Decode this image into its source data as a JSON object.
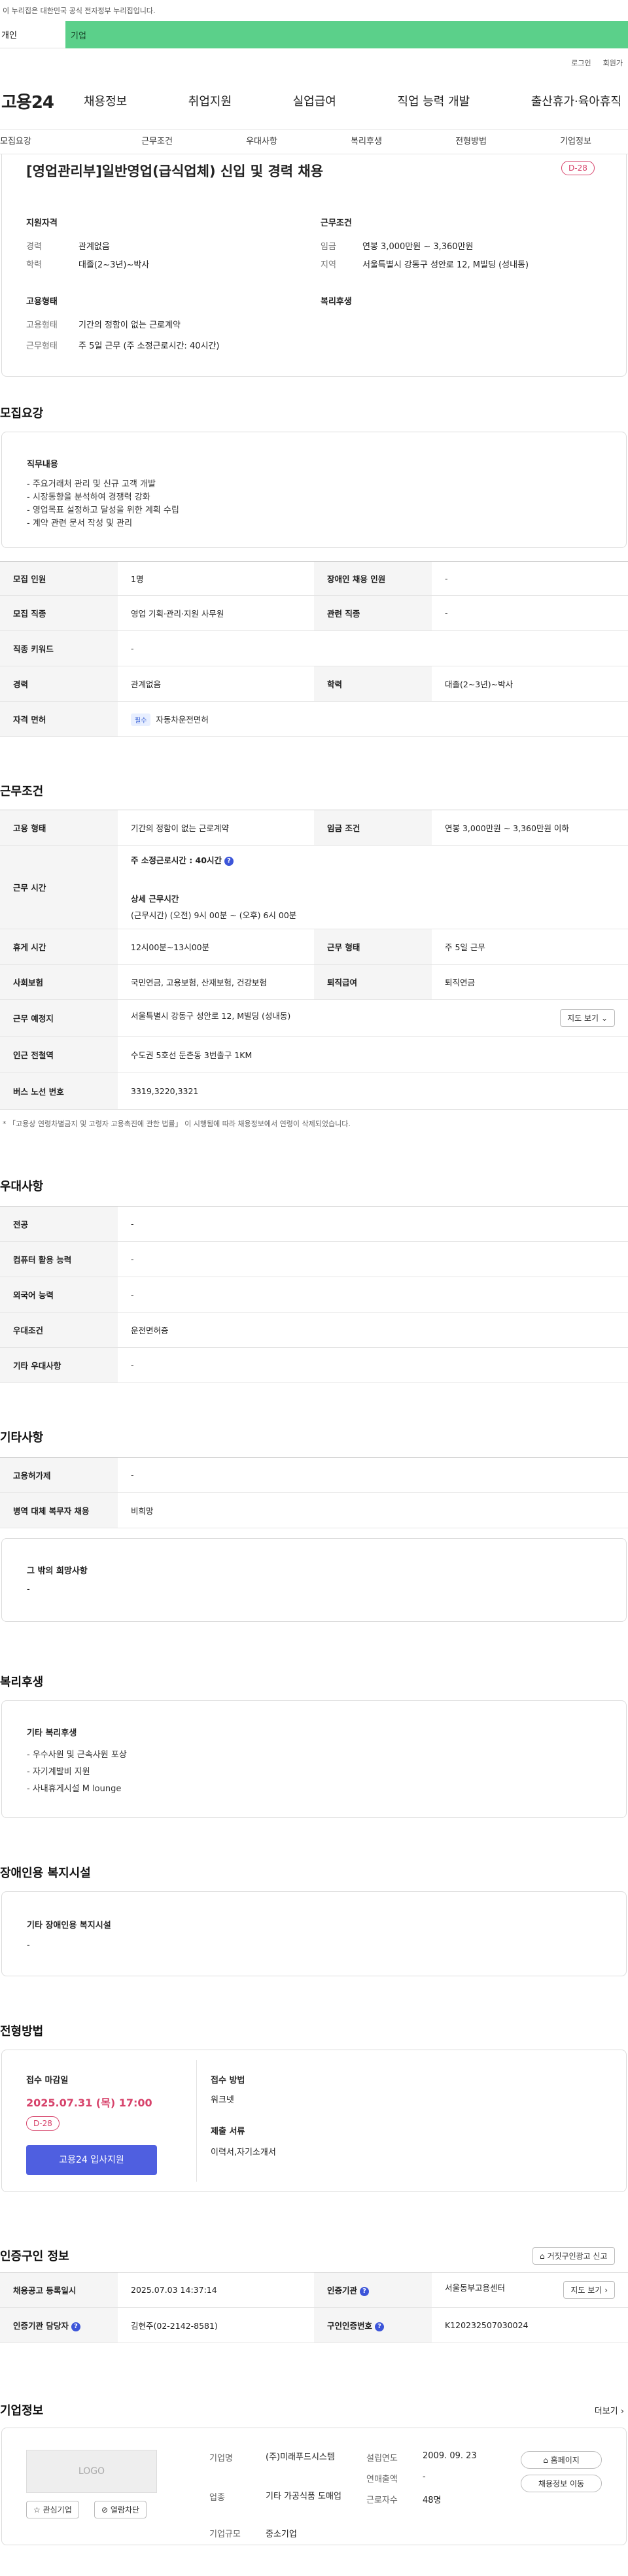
{
  "gov_bar": {
    "text": "이 누리집은 대한민국 공식 전자정부 누리집입니다."
  },
  "tabs": [
    {
      "label": "개인"
    },
    {
      "label": "기업"
    }
  ],
  "top_links": [
    {
      "label": "로그인"
    },
    {
      "label": "회원가"
    }
  ],
  "gnb": {
    "logo": "고용24",
    "items": [
      {
        "label": "채용정보"
      },
      {
        "label": "취업지원"
      },
      {
        "label": "실업급여"
      },
      {
        "label": "직업 능력 개발"
      },
      {
        "label": "출산휴가·육아휴직"
      }
    ]
  },
  "subnav": [
    {
      "label": "모집요강"
    },
    {
      "label": "근무조건"
    },
    {
      "label": "우대사항"
    },
    {
      "label": "복리후생"
    },
    {
      "label": "전형방법"
    },
    {
      "label": "기업정보"
    }
  ],
  "summary": {
    "title": "[영업관리부]일반영업(급식업체) 신입 및 경력 채용",
    "dday": "D-28",
    "qual_heading": "지원자격",
    "career_k": "경력",
    "career_v": "관계없음",
    "edu_k": "학력",
    "edu_v": "대졸(2~3년)~박사",
    "cond_heading": "근무조건",
    "wage_k": "임금",
    "wage_v": "연봉 3,000만원 ~ 3,360만원",
    "region_k": "지역",
    "region_v": "서울특별시 강동구 성안로 12, M빌딩 (성내동)",
    "emp_heading": "고용형태",
    "type_k": "고용형태",
    "type_v": "기간의 정함이 없는 근로계약",
    "form_k": "근무형태",
    "form_v": "주 5일 근무 (주 소정근로시간: 40시간)",
    "welfare_heading": "복리후생"
  },
  "recruit": {
    "title": "모집요강",
    "duty_heading": "직무내용",
    "duties": [
      "- 주요거래처 관리 및 신규 고객 개발",
      "- 시장동향을 분석하여 경쟁력 강화",
      "- 영업목표 설정하고 달성을 위한 계획 수립",
      "- 계약 관련 문서 작성 및 관리"
    ],
    "rows": [
      {
        "k1": "모집 인원",
        "v1": "1명",
        "k2": "장애인 채용 인원",
        "v2": "-"
      },
      {
        "k1": "모집 직종",
        "v1": "영업 기획·관리·지원 사무원",
        "k2": "관련 직종",
        "v2": "-"
      },
      {
        "k1": "직종 키워드",
        "v1": "-"
      },
      {
        "k1": "경력",
        "v1": "관계없음",
        "k2": "학력",
        "v2": "대졸(2~3년)~박사"
      },
      {
        "k1": "자격 면허",
        "badge": "필수",
        "v1": "자동차운전면허"
      }
    ]
  },
  "work": {
    "title": "근무조건",
    "emp_type_k": "고용 형태",
    "emp_type_v": "기간의 정함이 없는 근로계약",
    "wage_k": "임금 조건",
    "wage_v": "연봉 3,000만원 ~ 3,360만원 이하",
    "hours_k": "근무 시간",
    "hours_weekly": "주 소정근로시간 : 40시간",
    "hours_detail_h": "상세 근무시간",
    "hours_detail": "(근무시간) (오전) 9시 00분 ~ (오후) 6시 00분",
    "rest_k": "휴게 시간",
    "rest_v": "12시00분~13시00분",
    "form_k": "근무 형태",
    "form_v": "주 5일 근무",
    "ins_k": "사회보험",
    "ins_v": "국민연금, 고용보험, 산재보험, 건강보험",
    "sev_k": "퇴직급여",
    "sev_v": "퇴직연금",
    "loc_k": "근무 예정지",
    "loc_v": "서울특별시 강동구 성안로 12, M빌딩 (성내동)",
    "map_btn": "지도 보기",
    "subway_k": "인근 전철역",
    "subway_v": "수도권 5호선 둔촌동 3번출구 1KM",
    "bus_k": "버스 노선 번호",
    "bus_v": "3319,3220,3321",
    "note": "* 「고용상 연령차별금지 및 고령자 고용촉진에 관한 법률」 이 시행됨에 따라 채용정보에서 연령이 삭제되었습니다."
  },
  "pref": {
    "title": "우대사항",
    "rows": [
      {
        "k": "전공",
        "v": "-"
      },
      {
        "k": "컴퓨터 활용 능력",
        "v": "-"
      },
      {
        "k": "외국어 능력",
        "v": "-"
      },
      {
        "k": "우대조건",
        "v": "운전면허증"
      },
      {
        "k": "기타 우대사항",
        "v": "-"
      }
    ]
  },
  "etc": {
    "title": "기타사항",
    "rows": [
      {
        "k": "고용허가제",
        "v": "-"
      },
      {
        "k": "병역 대체 복무자 채용",
        "v": "비희망"
      }
    ],
    "other_h": "그 밖의 희망사항",
    "other_v": "-"
  },
  "welfare": {
    "title": "복리후생",
    "box_h": "기타 복리후생",
    "items": [
      "- 우수사원 및 근속사원 포상",
      "- 자기계발비 지원",
      "- 사내휴게시설 M lounge"
    ]
  },
  "disab": {
    "title": "장애인용 복지시설",
    "box_h": "기타 장애인용 복지시설",
    "v": "-"
  },
  "process": {
    "title": "전형방법",
    "deadline_h": "접수 마감일",
    "deadline": "2025.07.31 (목) 17:00",
    "dday": "D-28",
    "apply_btn": "고용24 입사지원",
    "method_h": "접수 방법",
    "method_v": "워크넷",
    "docs_h": "제출 서류",
    "docs_v": "이력서,자기소개서"
  },
  "cert": {
    "title": "인증구인 정보",
    "report_btn": "거짓구인광고 신고",
    "r1k1": "채용공고 등록일시",
    "r1v1": "2025.07.03 14:37:14",
    "r1k2": "인증기관",
    "r1v2": "서울동부고용센터",
    "map_btn": "지도 보기",
    "r2k1": "인증기관 담당자",
    "r2v1": "김현주(02-2142-8581)",
    "r2k2": "구인인증번호",
    "r2v2": "K120232507030024"
  },
  "company": {
    "title": "기업정보",
    "more": "더보기",
    "logo": "LOGO",
    "fav_btn": "관심기업",
    "block_btn": "열람차단",
    "name_k": "기업명",
    "name_v": "(주)미래푸드시스템",
    "ind_k": "업종",
    "ind_v": "기타 가공식품 도매업",
    "size_k": "기업규모",
    "size_v": "중소기업",
    "est_k": "설립연도",
    "est_v": "2009. 09. 23",
    "sales_k": "연매출액",
    "sales_v": "-",
    "emp_k": "근로자수",
    "emp_v": "48명",
    "home_btn": "홈페이지",
    "jobs_btn": "채용정보 이동"
  }
}
